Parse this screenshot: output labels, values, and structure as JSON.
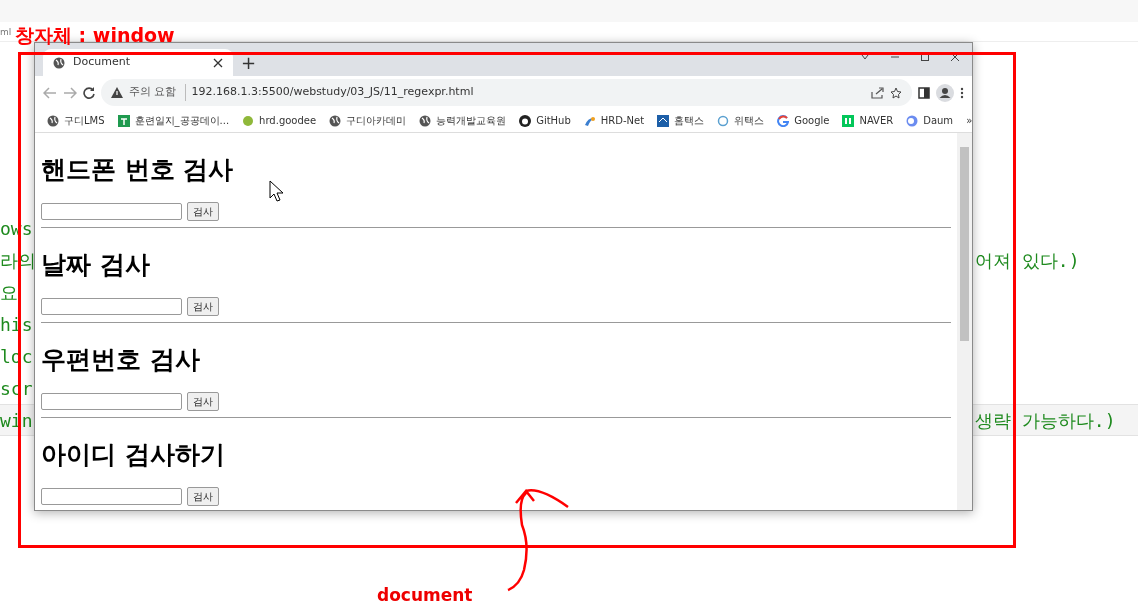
{
  "editor": {
    "breadcrumb": "ml",
    "lines": [
      {
        "left": "ows",
        "current": false
      },
      {
        "left": "라의",
        "right": "어져 있다.)",
        "current": false
      },
      {
        "left": "요",
        "current": false
      },
      {
        "left": "his",
        "current": false
      },
      {
        "left": "loc",
        "current": false
      },
      {
        "left": "scr",
        "current": false
      },
      {
        "left": "win",
        "right": "생략 가능하다.)",
        "current": true
      }
    ]
  },
  "browser": {
    "tab": {
      "title": "Document",
      "selected": true
    },
    "new_tab": "+",
    "address": {
      "security": "주의 요함",
      "url": "192.168.1.3:5500/webstudy/03_JS/11_regexpr.html"
    },
    "bookmarks": [
      {
        "label": "구디LMS",
        "kind": "globe"
      },
      {
        "label": "훈련일지_공공데이...",
        "kind": "green-square"
      },
      {
        "label": "hrd.goodee",
        "kind": "dot"
      },
      {
        "label": "구디아카데미",
        "kind": "globe"
      },
      {
        "label": "능력개발교육원",
        "kind": "globe"
      },
      {
        "label": "GitHub",
        "kind": "github"
      },
      {
        "label": "HRD-Net",
        "kind": "swirl"
      },
      {
        "label": "홈택스",
        "kind": "house"
      },
      {
        "label": "위택스",
        "kind": "ring"
      },
      {
        "label": "Google",
        "kind": "g-logo"
      },
      {
        "label": "NAVER",
        "kind": "naver"
      },
      {
        "label": "Daum",
        "kind": "daum"
      }
    ],
    "more_bookmarks": "»",
    "sections": [
      {
        "heading": "핸드폰 번호 검사",
        "button": "검사"
      },
      {
        "heading": "날짜 검사",
        "button": "검사"
      },
      {
        "heading": "우편번호 검사",
        "button": "검사"
      },
      {
        "heading": "아이디 검사하기",
        "button": "검사"
      }
    ]
  },
  "annotations": [
    {
      "text": "창자체 : window",
      "kind": "frame-label"
    },
    {
      "text": "document",
      "kind": "arrow-label"
    }
  ]
}
